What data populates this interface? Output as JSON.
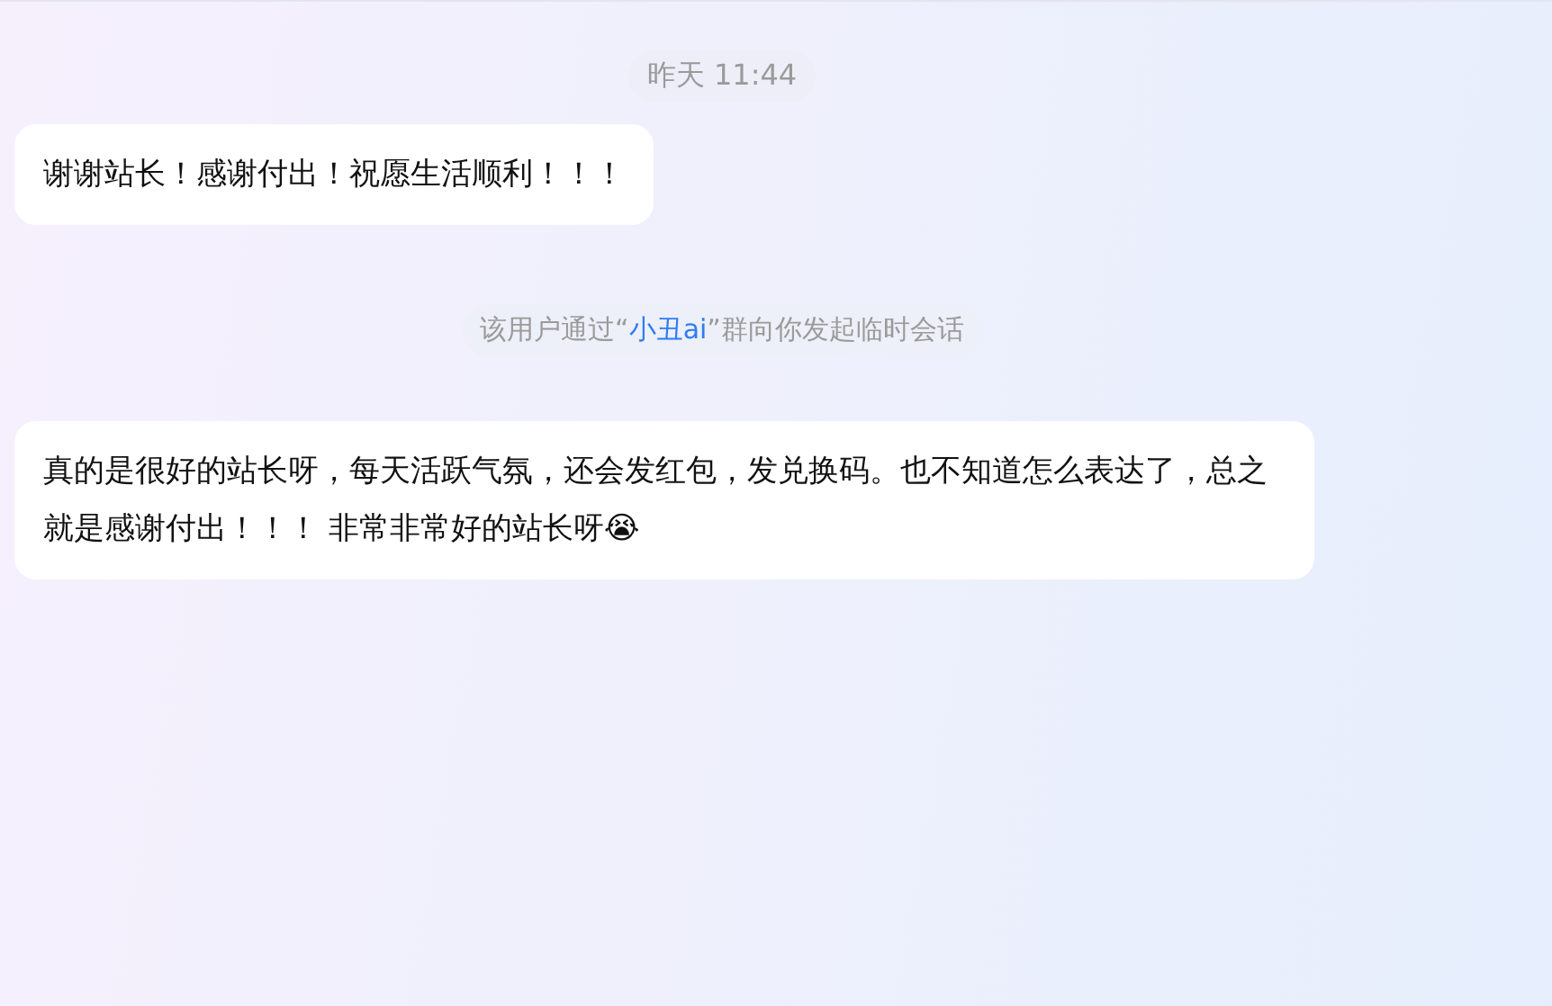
{
  "messages": [
    {
      "kind": "timestamp",
      "text": "昨天 11:44"
    },
    {
      "kind": "bubble",
      "text": "谢谢站长！感谢付出！祝愿生活顺利！！！"
    },
    {
      "kind": "system",
      "before": "该用户通过“",
      "link": "小丑ai",
      "after": "”群向你发起临时会话"
    },
    {
      "kind": "bubble",
      "text": "真的是很好的站长呀，每天活跃气氛，还会发红包，发兑换码。也不知道怎么表达了，总之就是感谢付出！！！ 非常非常好的站长呀😭"
    }
  ]
}
